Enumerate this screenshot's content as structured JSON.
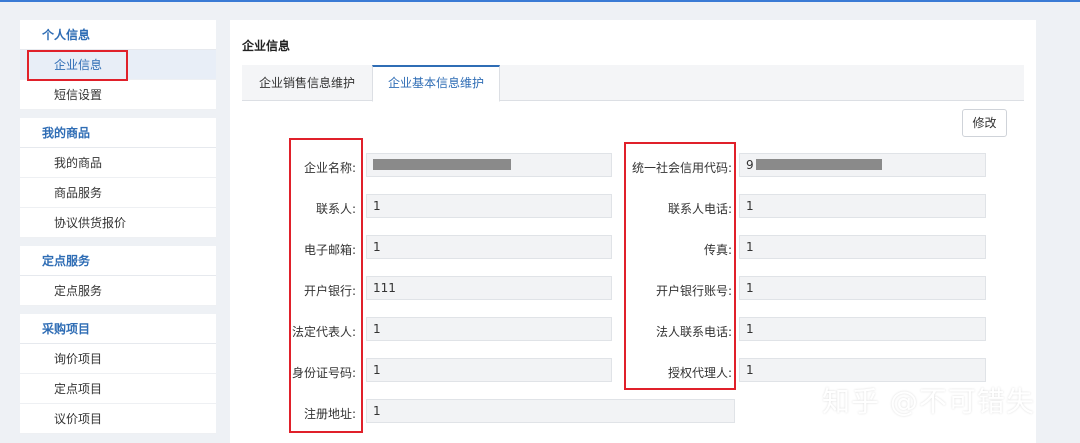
{
  "sidebar": {
    "groups": [
      {
        "title": "个人信息",
        "items": [
          "企业信息",
          "短信设置"
        ]
      },
      {
        "title": "我的商品",
        "items": [
          "我的商品",
          "商品服务",
          "协议供货报价"
        ]
      },
      {
        "title": "定点服务",
        "items": [
          "定点服务"
        ]
      },
      {
        "title": "采购项目",
        "items": [
          "询价项目",
          "定点项目",
          "议价项目"
        ]
      }
    ],
    "active_item": "企业信息"
  },
  "main": {
    "title": "企业信息",
    "tabs": [
      "企业销售信息维护",
      "企业基本信息维护"
    ],
    "active_tab": "企业基本信息维护",
    "edit_label": "修改",
    "form": {
      "company_name": {
        "label": "企业名称:",
        "value": ""
      },
      "credit_code": {
        "label": "统一社会信用代码:",
        "value": "9"
      },
      "contact": {
        "label": "联系人:",
        "value": "1"
      },
      "contact_phone": {
        "label": "联系人电话:",
        "value": "1"
      },
      "email": {
        "label": "电子邮箱:",
        "value": "1"
      },
      "fax": {
        "label": "传真:",
        "value": "1"
      },
      "bank": {
        "label": "开户银行:",
        "value": "111"
      },
      "bank_account": {
        "label": "开户银行账号:",
        "value": "1"
      },
      "legal_rep": {
        "label": "法定代表人:",
        "value": "1"
      },
      "legal_phone": {
        "label": "法人联系电话:",
        "value": "1"
      },
      "id_number": {
        "label": "身份证号码:",
        "value": "1"
      },
      "agent": {
        "label": "授权代理人:",
        "value": "1"
      },
      "address": {
        "label": "注册地址:",
        "value": "1"
      }
    }
  },
  "watermark": "知乎 @不可错失",
  "colors": {
    "accent": "#2f6db5",
    "highlight": "#e0202a",
    "field_bg": "#f2f3f5"
  }
}
